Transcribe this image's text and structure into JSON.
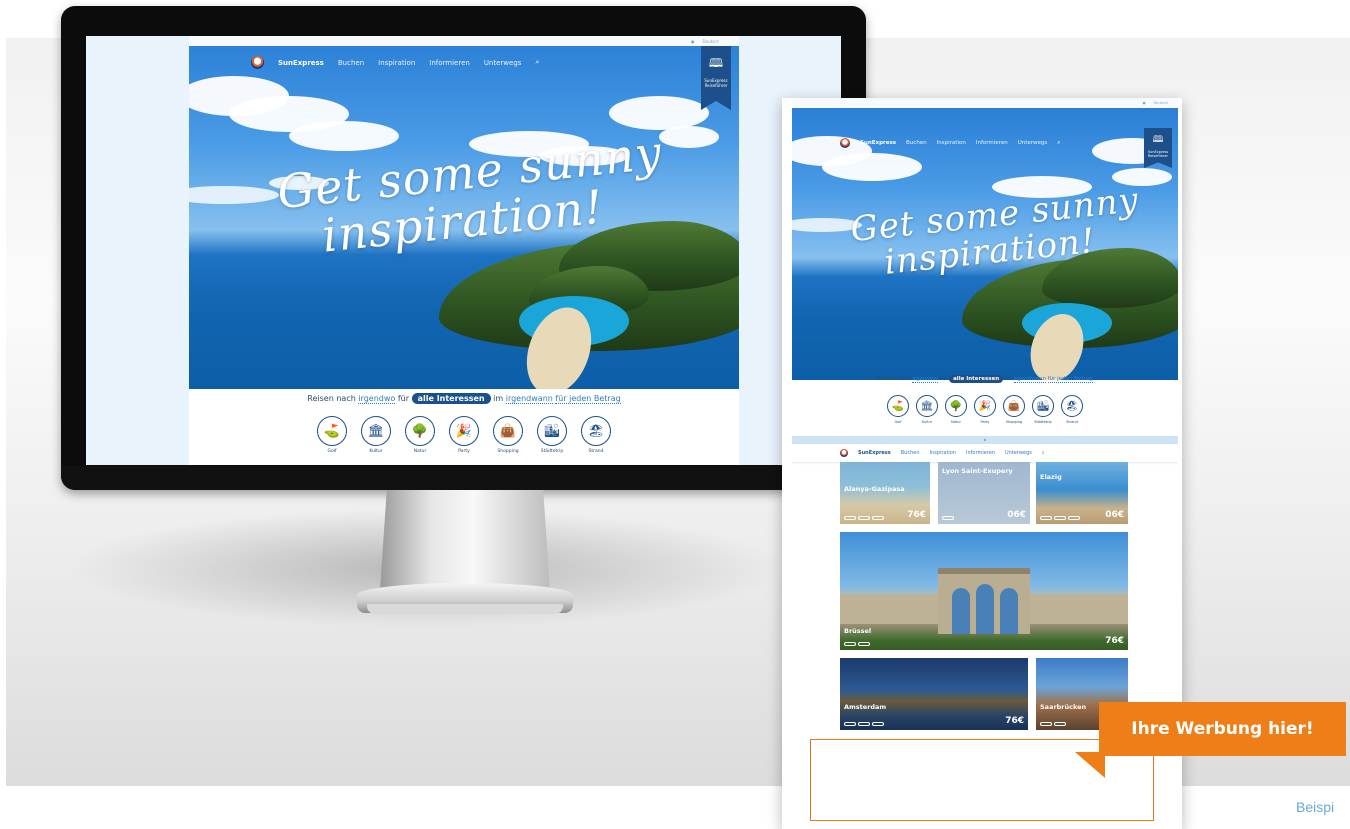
{
  "site": {
    "brand": "SunExpress",
    "nav_items": [
      "Buchen",
      "Inspiration",
      "Informieren",
      "Unterwegs"
    ],
    "hero_line1": "Get some sunny",
    "hero_line2": "inspiration!",
    "bookmark_label": "SunExpress Reiseführer",
    "filter": {
      "p1": "Reisen nach",
      "w1": "irgendwo",
      "p2": "für",
      "pill": "alle Interessen",
      "p3": "im",
      "w2": "irgendwann",
      "p4": "für jeden Betrag"
    },
    "categories": [
      {
        "label": "Golf",
        "icon": "golf-icon",
        "glyph": "⛳"
      },
      {
        "label": "Kultur",
        "icon": "columns-icon",
        "glyph": "🏛"
      },
      {
        "label": "Natur",
        "icon": "tree-icon",
        "glyph": "🌳"
      },
      {
        "label": "Party",
        "icon": "party-icon",
        "glyph": "🎉"
      },
      {
        "label": "Shopping",
        "icon": "shopping-bag-icon",
        "glyph": "👜"
      },
      {
        "label": "Städtetrip",
        "icon": "city-icon",
        "glyph": "🏙"
      },
      {
        "label": "Strand",
        "icon": "beach-icon",
        "glyph": "🏖"
      }
    ],
    "topbar_lang": "Deutsch"
  },
  "destinations": [
    {
      "name": "Alanya-Gazipasa",
      "price": "76€"
    },
    {
      "name": "Lyon Saint-Exupery",
      "price": "06€"
    },
    {
      "name": "Elazig",
      "price": "06€"
    },
    {
      "name": "Brüssel",
      "price": "76€"
    },
    {
      "name": "Amsterdam",
      "price": "76€"
    },
    {
      "name": "Saarbrücken",
      "price": ""
    }
  ],
  "ad": {
    "label": "Ihre Werbung hier!",
    "footnote": "Beispi"
  },
  "colors": {
    "accent_orange": "#ee7f18",
    "brand_blue": "#1d4f8a",
    "link_blue": "#2f7bc0"
  }
}
